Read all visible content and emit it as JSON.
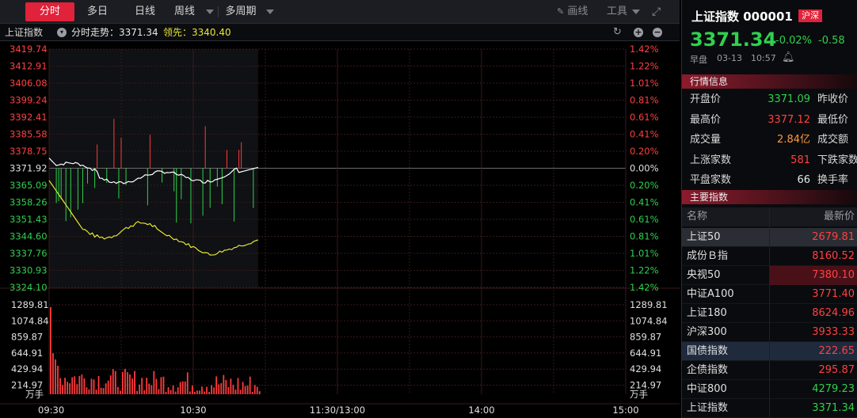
{
  "toolbar": {
    "tabs": [
      {
        "label": "分时",
        "active": true
      },
      {
        "label": "多日",
        "active": false
      },
      {
        "label": "日线",
        "active": false
      },
      {
        "label": "周线",
        "active": false
      },
      {
        "label": "多周期",
        "active": false
      }
    ],
    "draw_label": "画线",
    "tools_label": "工具"
  },
  "infobar": {
    "index_name": "上证指数",
    "trend_label": "分时走势：3371.34",
    "lead_label": "领先：3340.40"
  },
  "chart_data": {
    "type": "line",
    "price_axis_left": [
      "3419.74",
      "3412.91",
      "3406.08",
      "3399.24",
      "3392.41",
      "3385.58",
      "3378.75",
      "3371.92",
      "3365.09",
      "3358.26",
      "3351.43",
      "3344.60",
      "3337.76",
      "3330.93",
      "3324.10"
    ],
    "price_axis_right": [
      "1.42%",
      "1.22%",
      "1.01%",
      "0.81%",
      "0.61%",
      "0.41%",
      "0.20%",
      "0.00%",
      "0.20%",
      "0.41%",
      "0.61%",
      "0.81%",
      "1.01%",
      "1.22%",
      "1.42%"
    ],
    "volume_axis": [
      "1289.81",
      "1074.84",
      "859.87",
      "644.91",
      "429.94",
      "214.97"
    ],
    "volume_unit": "万手",
    "time_labels": [
      "09:30",
      "10:30",
      "11:30/13:00",
      "14:00",
      "15:00"
    ],
    "prev_close": 3371.92,
    "price_range": [
      3324.1,
      3419.74
    ],
    "colors": {
      "price": "#ffffff",
      "lead": "#e6e633",
      "up": "#ff3b3b",
      "down": "#2fd14d",
      "volume": "#ff3b3b",
      "grid": "#3a1a1a"
    }
  },
  "quote": {
    "title": "上证指数 000001",
    "badge": "沪深",
    "price": "3371.34",
    "change_pct": "-0.02%",
    "change": "-0.58",
    "session": "早盘",
    "date": "03-13",
    "time": "10:57"
  },
  "market_info": {
    "header": "行情信息",
    "rows": [
      {
        "label": "开盘价",
        "value": "3371.09",
        "color": "green",
        "label2": "昨收价"
      },
      {
        "label": "最高价",
        "value": "3377.12",
        "color": "red",
        "label2": "最低价"
      },
      {
        "label": "成交量",
        "value": "2.84亿",
        "color": "orange",
        "label2": "成交额"
      },
      {
        "label": "上涨家数",
        "value": "581",
        "color": "red",
        "label2": "下跌家数"
      },
      {
        "label": "平盘家数",
        "value": "66",
        "color": "white",
        "label2": "换手率"
      }
    ]
  },
  "main_indices": {
    "header": "主要指数",
    "col_name": "名称",
    "col_price": "最新价",
    "rows": [
      {
        "name": "上证50",
        "price": "2679.81",
        "color": "red",
        "style": "sel"
      },
      {
        "name": "成份Ｂ指",
        "price": "8160.52",
        "color": "red",
        "style": ""
      },
      {
        "name": "央视50",
        "price": "7380.10",
        "color": "red",
        "style": "hl"
      },
      {
        "name": "中证A100",
        "price": "3771.40",
        "color": "red",
        "style": ""
      },
      {
        "name": "上证180",
        "price": "8624.96",
        "color": "red",
        "style": ""
      },
      {
        "name": "沪深300",
        "price": "3933.33",
        "color": "red",
        "style": ""
      },
      {
        "name": "国债指数",
        "price": "222.65",
        "color": "red",
        "style": "sel2"
      },
      {
        "name": "企债指数",
        "price": "295.87",
        "color": "red",
        "style": ""
      },
      {
        "name": "中证800",
        "price": "4279.23",
        "color": "green",
        "style": ""
      },
      {
        "name": "上证指数",
        "price": "3371.34",
        "color": "green",
        "style": ""
      }
    ]
  }
}
